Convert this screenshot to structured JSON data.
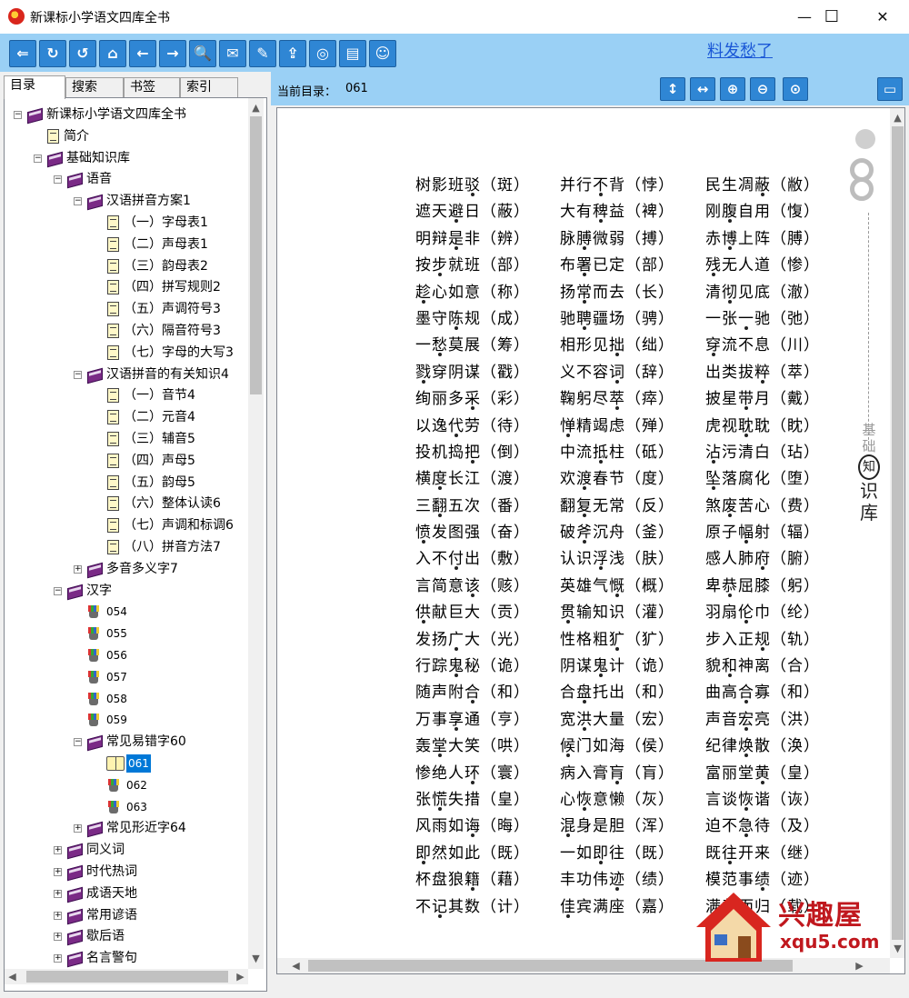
{
  "window": {
    "title": "新课标小学语文四库全书",
    "min": "—",
    "max": "☐",
    "close": "✕"
  },
  "toolbar": {
    "buttons": [
      "⇐",
      "↻",
      "↺",
      "⌂",
      "←",
      "→",
      "🔍",
      "✉",
      "✎",
      "⇪",
      "◎",
      "▤",
      "☺"
    ],
    "link": "料发愁了"
  },
  "tabs": [
    "目录",
    "搜索",
    "书签",
    "索引"
  ],
  "tree": [
    {
      "level": 0,
      "type": "book",
      "exp": "−",
      "label": "新课标小学语文四库全书"
    },
    {
      "level": 1,
      "type": "page",
      "exp": "",
      "label": "简介"
    },
    {
      "level": 1,
      "type": "book",
      "exp": "−",
      "label": "基础知识库"
    },
    {
      "level": 2,
      "type": "book",
      "exp": "−",
      "label": "语音"
    },
    {
      "level": 3,
      "type": "book",
      "exp": "−",
      "label": "汉语拼音方案1"
    },
    {
      "level": 4,
      "type": "page",
      "exp": "",
      "label": "（一）字母表1"
    },
    {
      "level": 4,
      "type": "page",
      "exp": "",
      "label": "（二）声母表1"
    },
    {
      "level": 4,
      "type": "page",
      "exp": "",
      "label": "（三）韵母表2"
    },
    {
      "level": 4,
      "type": "page",
      "exp": "",
      "label": "（四）拼写规则2"
    },
    {
      "level": 4,
      "type": "page",
      "exp": "",
      "label": "（五）声调符号3"
    },
    {
      "level": 4,
      "type": "page",
      "exp": "",
      "label": "（六）隔音符号3"
    },
    {
      "level": 4,
      "type": "page",
      "exp": "",
      "label": "（七）字母的大写3"
    },
    {
      "level": 3,
      "type": "book",
      "exp": "−",
      "label": "汉语拼音的有关知识4"
    },
    {
      "level": 4,
      "type": "page",
      "exp": "",
      "label": "（一）音节4"
    },
    {
      "level": 4,
      "type": "page",
      "exp": "",
      "label": "（二）元音4"
    },
    {
      "level": 4,
      "type": "page",
      "exp": "",
      "label": "（三）辅音5"
    },
    {
      "level": 4,
      "type": "page",
      "exp": "",
      "label": "（四）声母5"
    },
    {
      "level": 4,
      "type": "page",
      "exp": "",
      "label": "（五）韵母5"
    },
    {
      "level": 4,
      "type": "page",
      "exp": "",
      "label": "（六）整体认读6"
    },
    {
      "level": 4,
      "type": "page",
      "exp": "",
      "label": "（七）声调和标调6"
    },
    {
      "level": 4,
      "type": "page",
      "exp": "",
      "label": "（八）拼音方法7"
    },
    {
      "level": 3,
      "type": "book",
      "exp": "+",
      "label": "多音多义字7"
    },
    {
      "level": 2,
      "type": "book",
      "exp": "−",
      "label": "汉字"
    },
    {
      "level": 3,
      "type": "cup",
      "exp": "",
      "label": "054"
    },
    {
      "level": 3,
      "type": "cup",
      "exp": "",
      "label": "055"
    },
    {
      "level": 3,
      "type": "cup",
      "exp": "",
      "label": "056"
    },
    {
      "level": 3,
      "type": "cup",
      "exp": "",
      "label": "057"
    },
    {
      "level": 3,
      "type": "cup",
      "exp": "",
      "label": "058"
    },
    {
      "level": 3,
      "type": "cup",
      "exp": "",
      "label": "059"
    },
    {
      "level": 3,
      "type": "book",
      "exp": "−",
      "label": "常见易错字60"
    },
    {
      "level": 4,
      "type": "open",
      "exp": "",
      "label": "061",
      "selected": true
    },
    {
      "level": 4,
      "type": "cup",
      "exp": "",
      "label": "062"
    },
    {
      "level": 4,
      "type": "cup",
      "exp": "",
      "label": "063"
    },
    {
      "level": 3,
      "type": "book",
      "exp": "+",
      "label": "常见形近字64"
    },
    {
      "level": 2,
      "type": "book",
      "exp": "+",
      "label": "同义词"
    },
    {
      "level": 2,
      "type": "book",
      "exp": "+",
      "label": "时代热词"
    },
    {
      "level": 2,
      "type": "book",
      "exp": "+",
      "label": "成语天地"
    },
    {
      "level": 2,
      "type": "book",
      "exp": "+",
      "label": "常用谚语"
    },
    {
      "level": 2,
      "type": "book",
      "exp": "+",
      "label": "歇后语"
    },
    {
      "level": 2,
      "type": "book",
      "exp": "+",
      "label": "名言警句"
    }
  ],
  "current": {
    "label": "当前目录：",
    "value": "061"
  },
  "view_buttons": [
    "↕",
    "↔",
    "⊕",
    "⊖",
    "⊙"
  ],
  "columns": [
    [
      [
        "树影班驳（斑）",
        3
      ],
      [
        "遮天避日（蔽）",
        2
      ],
      [
        "明辩是非（辨）",
        2
      ],
      [
        "按步就班（部）",
        1
      ],
      [
        "趁心如意（称）",
        0
      ],
      [
        "墨守陈规（成）",
        2
      ],
      [
        "一愁莫展（筹）",
        1
      ],
      [
        "戮穿阴谋（戳）",
        0
      ],
      [
        "绚丽多采（彩）",
        3
      ],
      [
        "以逸代劳（待）",
        2
      ],
      [
        "投机捣把（倒）",
        3
      ],
      [
        "横度长江（渡）",
        1
      ],
      [
        "三翻五次（番）",
        1
      ],
      [
        "愤发图强（奋）",
        0
      ],
      [
        "入不付出（敷）",
        2
      ],
      [
        "言简意该（赅）",
        3
      ],
      [
        "供献巨大（贡）",
        0
      ],
      [
        "发扬广大（光）",
        2
      ],
      [
        "行踪鬼秘（诡）",
        2
      ],
      [
        "随声附合（和）",
        3
      ],
      [
        "万事享通（亨）",
        2
      ],
      [
        "轰堂大笑（哄）",
        1
      ],
      [
        "惨绝人环（寰）",
        3
      ],
      [
        "张慌失措（皇）",
        1
      ],
      [
        "风雨如诲（晦）",
        3
      ],
      [
        "即然如此（既）",
        0
      ],
      [
        "杯盘狼籍（藉）",
        3
      ],
      [
        "不记其数（计）",
        1
      ]
    ],
    [
      [
        "并行不背（悖）",
        2
      ],
      [
        "大有稗益（裨）",
        2
      ],
      [
        "脉膊微弱（搏）",
        1
      ],
      [
        "布署已定（部）",
        1
      ],
      [
        "扬常而去（长）",
        1
      ],
      [
        "驰聘疆场（骋）",
        1
      ],
      [
        "相形见拙（绌）",
        3
      ],
      [
        "义不容词（辞）",
        3
      ],
      [
        "鞠躬尽萃（瘁）",
        3
      ],
      [
        "惮精竭虑（殚）",
        0
      ],
      [
        "中流抵柱（砥）",
        2
      ],
      [
        "欢渡春节（度）",
        1
      ],
      [
        "翻复无常（反）",
        1
      ],
      [
        "破斧沉舟（釜）",
        1
      ],
      [
        "认识浮浅（肤）",
        2
      ],
      [
        "英雄气慨（概）",
        3
      ],
      [
        "贯输知识（灌）",
        0
      ],
      [
        "性格粗犷（犷）",
        3
      ],
      [
        "阴谋鬼计（诡）",
        2
      ],
      [
        "合盘托出（和）",
        1
      ],
      [
        "宽洪大量（宏）",
        1
      ],
      [
        "候门如海（侯）",
        0
      ],
      [
        "病入膏肓（肓）",
        3
      ],
      [
        "心恢意懒（灰）",
        1
      ],
      [
        "混身是胆（浑）",
        0
      ],
      [
        "一如即往（既）",
        2
      ],
      [
        "丰功伟迹（绩）",
        3
      ],
      [
        "佳宾满座（嘉）",
        0
      ]
    ],
    [
      [
        "民生凋蔽（敝）",
        3
      ],
      [
        "刚腹自用（愎）",
        1
      ],
      [
        "赤博上阵（膊）",
        1
      ],
      [
        "残无人道（惨）",
        0
      ],
      [
        "清彻见底（澈）",
        1
      ],
      [
        "一张一驰（弛）",
        2
      ],
      [
        "穿流不息（川）",
        0
      ],
      [
        "出类拔粹（萃）",
        3
      ],
      [
        "披星带月（戴）",
        2
      ],
      [
        "虎视耽耽（眈）",
        2
      ],
      [
        "沾污清白（玷）",
        0
      ],
      [
        "坠落腐化（堕）",
        0
      ],
      [
        "煞废苦心（费）",
        1
      ],
      [
        "原子幅射（辐）",
        2
      ],
      [
        "感人肺府（腑）",
        3
      ],
      [
        "卑恭屈膝（躬）",
        1
      ],
      [
        "羽扇伦巾（纶）",
        2
      ],
      [
        "步入正规（轨）",
        3
      ],
      [
        "貌和神离（合）",
        1
      ],
      [
        "曲高合寡（和）",
        2
      ],
      [
        "声音宏亮（洪）",
        2
      ],
      [
        "纪律焕散（涣）",
        2
      ],
      [
        "富丽堂黄（皇）",
        3
      ],
      [
        "言谈恢谐（诙）",
        2
      ],
      [
        "迫不急待（及）",
        2
      ],
      [
        "既往开来（继）",
        1
      ],
      [
        "模范事绩（迹）",
        3
      ],
      [
        "满载而归（载）",
        2
      ]
    ]
  ],
  "side_title": [
    "基",
    "础",
    "知",
    "识",
    "库"
  ],
  "watermark": {
    "text": "兴趣屋",
    "url": "xqu5.com"
  }
}
